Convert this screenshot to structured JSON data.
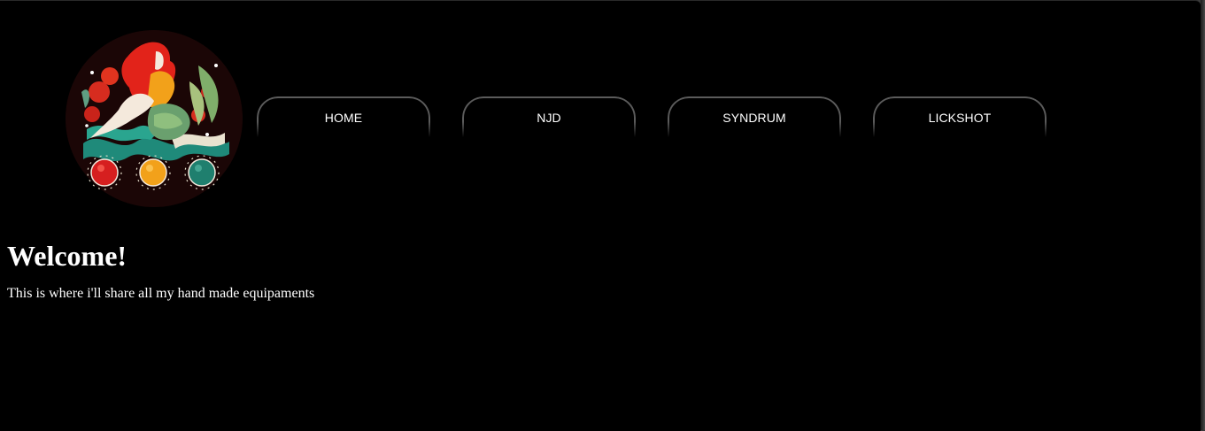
{
  "nav": {
    "items": [
      {
        "label": "HOME"
      },
      {
        "label": "NJD"
      },
      {
        "label": "SYNDRUM"
      },
      {
        "label": "LICKSHOT"
      }
    ]
  },
  "main": {
    "heading": "Welcome!",
    "intro": "This is where i'll share all my hand made equipaments"
  },
  "logo": {
    "icon": "mermaid-logo-icon",
    "lights": [
      "#d61f1f",
      "#f2a11a",
      "#1f7f6e"
    ]
  },
  "colors": {
    "background": "#000000",
    "text": "#ffffff",
    "nav_border": "#5b5b5b"
  }
}
